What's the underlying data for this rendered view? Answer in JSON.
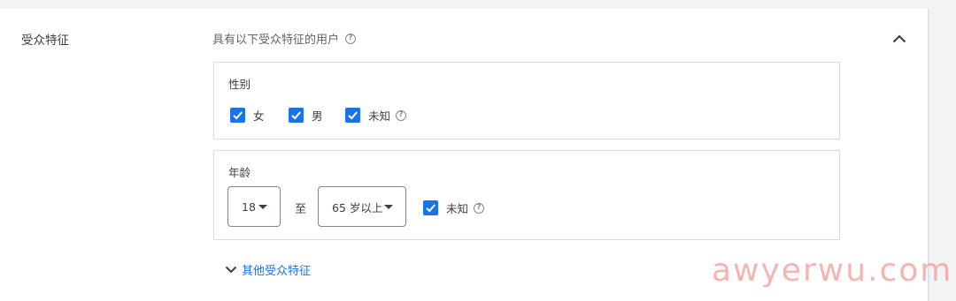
{
  "section": {
    "title": "受众特征",
    "header": "具有以下受众特征的用户"
  },
  "gender": {
    "label": "性别",
    "options": [
      {
        "label": "女",
        "checked": true
      },
      {
        "label": "男",
        "checked": true
      },
      {
        "label": "未知",
        "checked": true
      }
    ]
  },
  "age": {
    "label": "年龄",
    "from_value": "18",
    "to_text": "至",
    "to_value": "65 岁以上",
    "unknown_label": "未知",
    "unknown_checked": true
  },
  "more_link": "其他受众特征",
  "watermark": "awyerwu.com",
  "colors": {
    "accent": "#1a73e8",
    "text": "#3c4043",
    "border": "#dadce0",
    "background": "#f1f3f4",
    "watermark": "#f4a7a3"
  },
  "icons": {
    "help": "help-circle-icon",
    "collapse": "chevron-up-icon",
    "expand": "chevron-down-icon",
    "dropdown": "dropdown-caret-icon",
    "check": "checkmark-icon"
  }
}
